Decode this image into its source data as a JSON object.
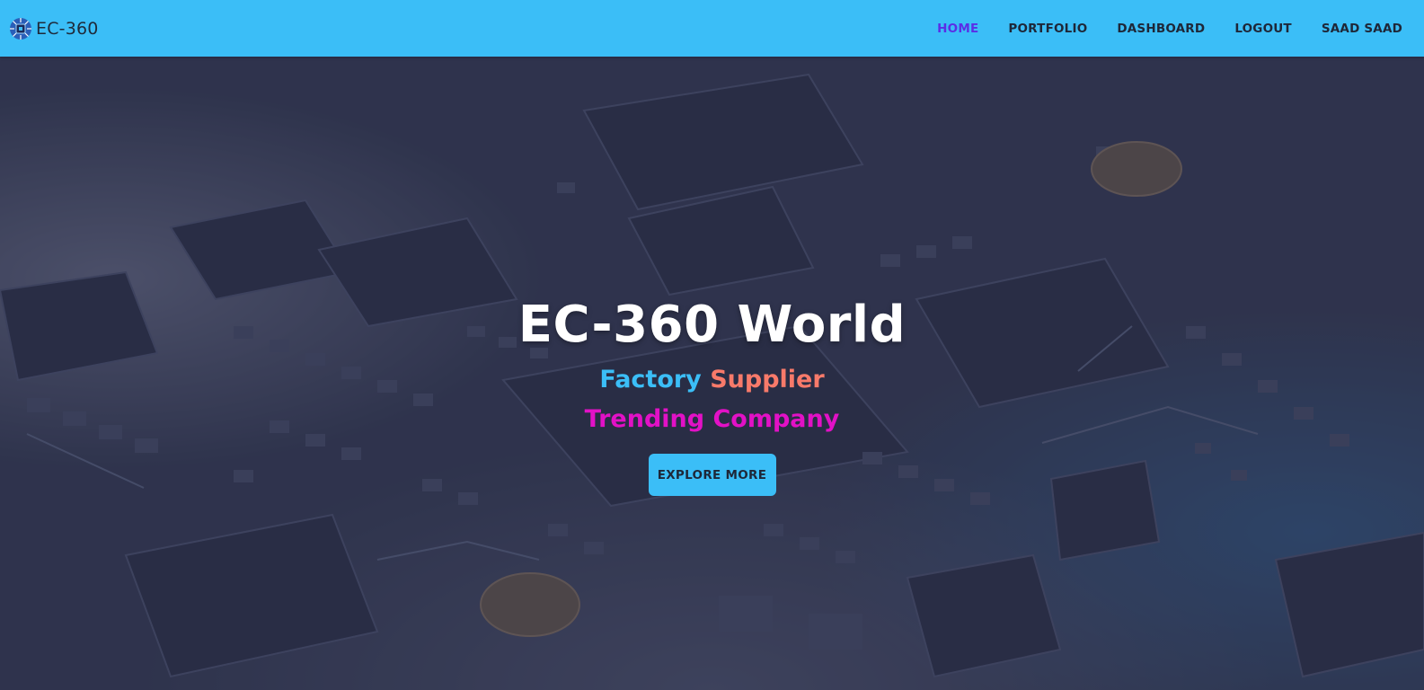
{
  "navbar": {
    "brand": "EC-360",
    "logo_icon": "chip-icon",
    "links": [
      {
        "label": "HOME",
        "active": true
      },
      {
        "label": "PORTFOLIO",
        "active": false
      },
      {
        "label": "DASHBOARD",
        "active": false
      },
      {
        "label": "LOGOUT",
        "active": false
      },
      {
        "label": "SAAD SAAD",
        "active": false
      }
    ]
  },
  "hero": {
    "title": "EC-360 World",
    "subtitle_word1": "Factory",
    "subtitle_word2": "Supplier",
    "subtitle_line2": "Trending Company",
    "button_label": "EXPLORE MORE",
    "background": "circuit-board-image"
  },
  "colors": {
    "accent": "#3bbef7",
    "active_link": "#5b2ee6",
    "supplier": "#f87a6a",
    "trending": "#e211c6"
  }
}
